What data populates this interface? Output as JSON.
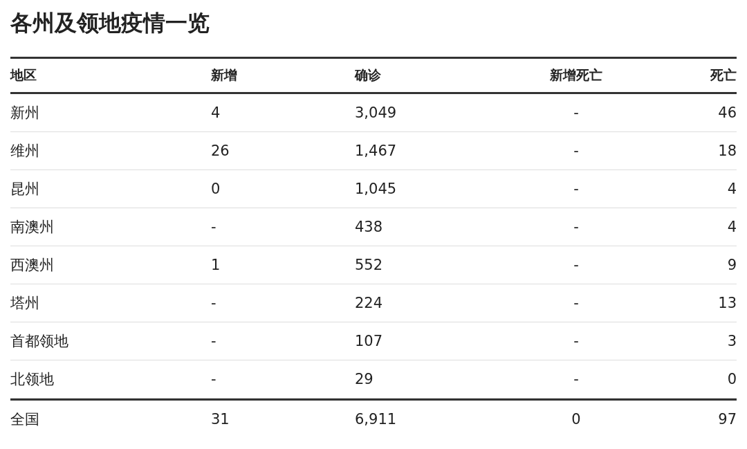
{
  "title": "各州及领地疫情一览",
  "table": {
    "columns": [
      "地区",
      "新增",
      "确诊",
      "新增死亡",
      "死亡"
    ],
    "rows": [
      [
        "新州",
        "4",
        "3,049",
        "-",
        "46"
      ],
      [
        "维州",
        "26",
        "1,467",
        "-",
        "18"
      ],
      [
        "昆州",
        "0",
        "1,045",
        "-",
        "4"
      ],
      [
        "南澳州",
        "-",
        "438",
        "-",
        "4"
      ],
      [
        "西澳州",
        "1",
        "552",
        "-",
        "9"
      ],
      [
        "塔州",
        "-",
        "224",
        "-",
        "13"
      ],
      [
        "首都领地",
        "-",
        "107",
        "-",
        "3"
      ],
      [
        "北领地",
        "-",
        "29",
        "-",
        "0"
      ]
    ],
    "total": [
      "全国",
      "31",
      "6,911",
      "0",
      "97"
    ]
  }
}
